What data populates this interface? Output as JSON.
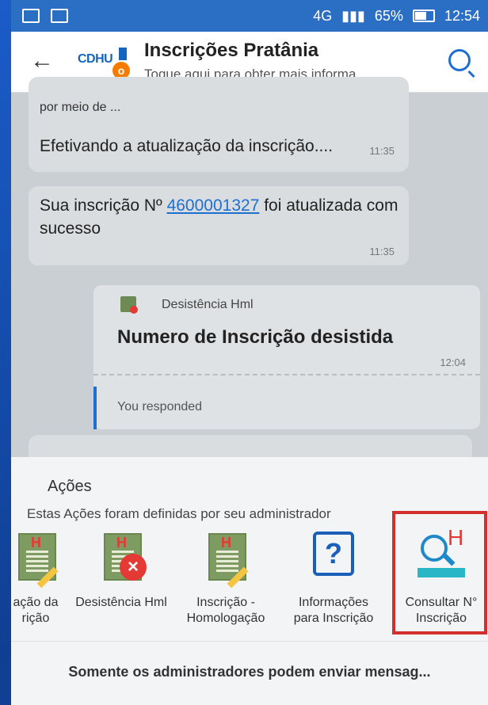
{
  "status_bar": {
    "network": "4G",
    "battery": "65%",
    "time": "12:54"
  },
  "header": {
    "logo": "CDHU",
    "title": "Inscrições Pratânia",
    "subtitle": "Toque aqui para obter mais informa.."
  },
  "messages": [
    {
      "from": "por meio de ...",
      "text": "Efetivando a atualização da inscrição....",
      "time": "11:35"
    },
    {
      "text_before": "Sua inscrição Nº ",
      "link": "4600001327",
      "text_after": " foi atualizada com sucesso",
      "time": "11:35"
    }
  ],
  "card": {
    "label": "Desistência Hml",
    "heading": "Numero de Inscrição desistida",
    "time": "12:04",
    "response": "You responded"
  },
  "sheet": {
    "title": "Ações",
    "subtitle": "Estas Ações foram definidas por seu administrador",
    "actions": [
      {
        "label1": "ação da",
        "label2": "rição",
        "icon": "document-edit-icon"
      },
      {
        "label1": "Desistência Hml",
        "label2": "",
        "icon": "document-cancel-icon"
      },
      {
        "label1": "Inscrição -",
        "label2": "Homologação",
        "icon": "document-edit-icon"
      },
      {
        "label1": "Informações",
        "label2": "para Inscrição",
        "icon": "question-icon"
      },
      {
        "label1": "Consultar N°",
        "label2": "Inscrição",
        "icon": "consult-icon"
      }
    ]
  },
  "footer": {
    "text": "Somente os administradores podem enviar mensag..."
  },
  "colors": {
    "statusbar": "#2b6fc4",
    "accent": "#1e6fd0",
    "highlight": "#d32f2f"
  }
}
